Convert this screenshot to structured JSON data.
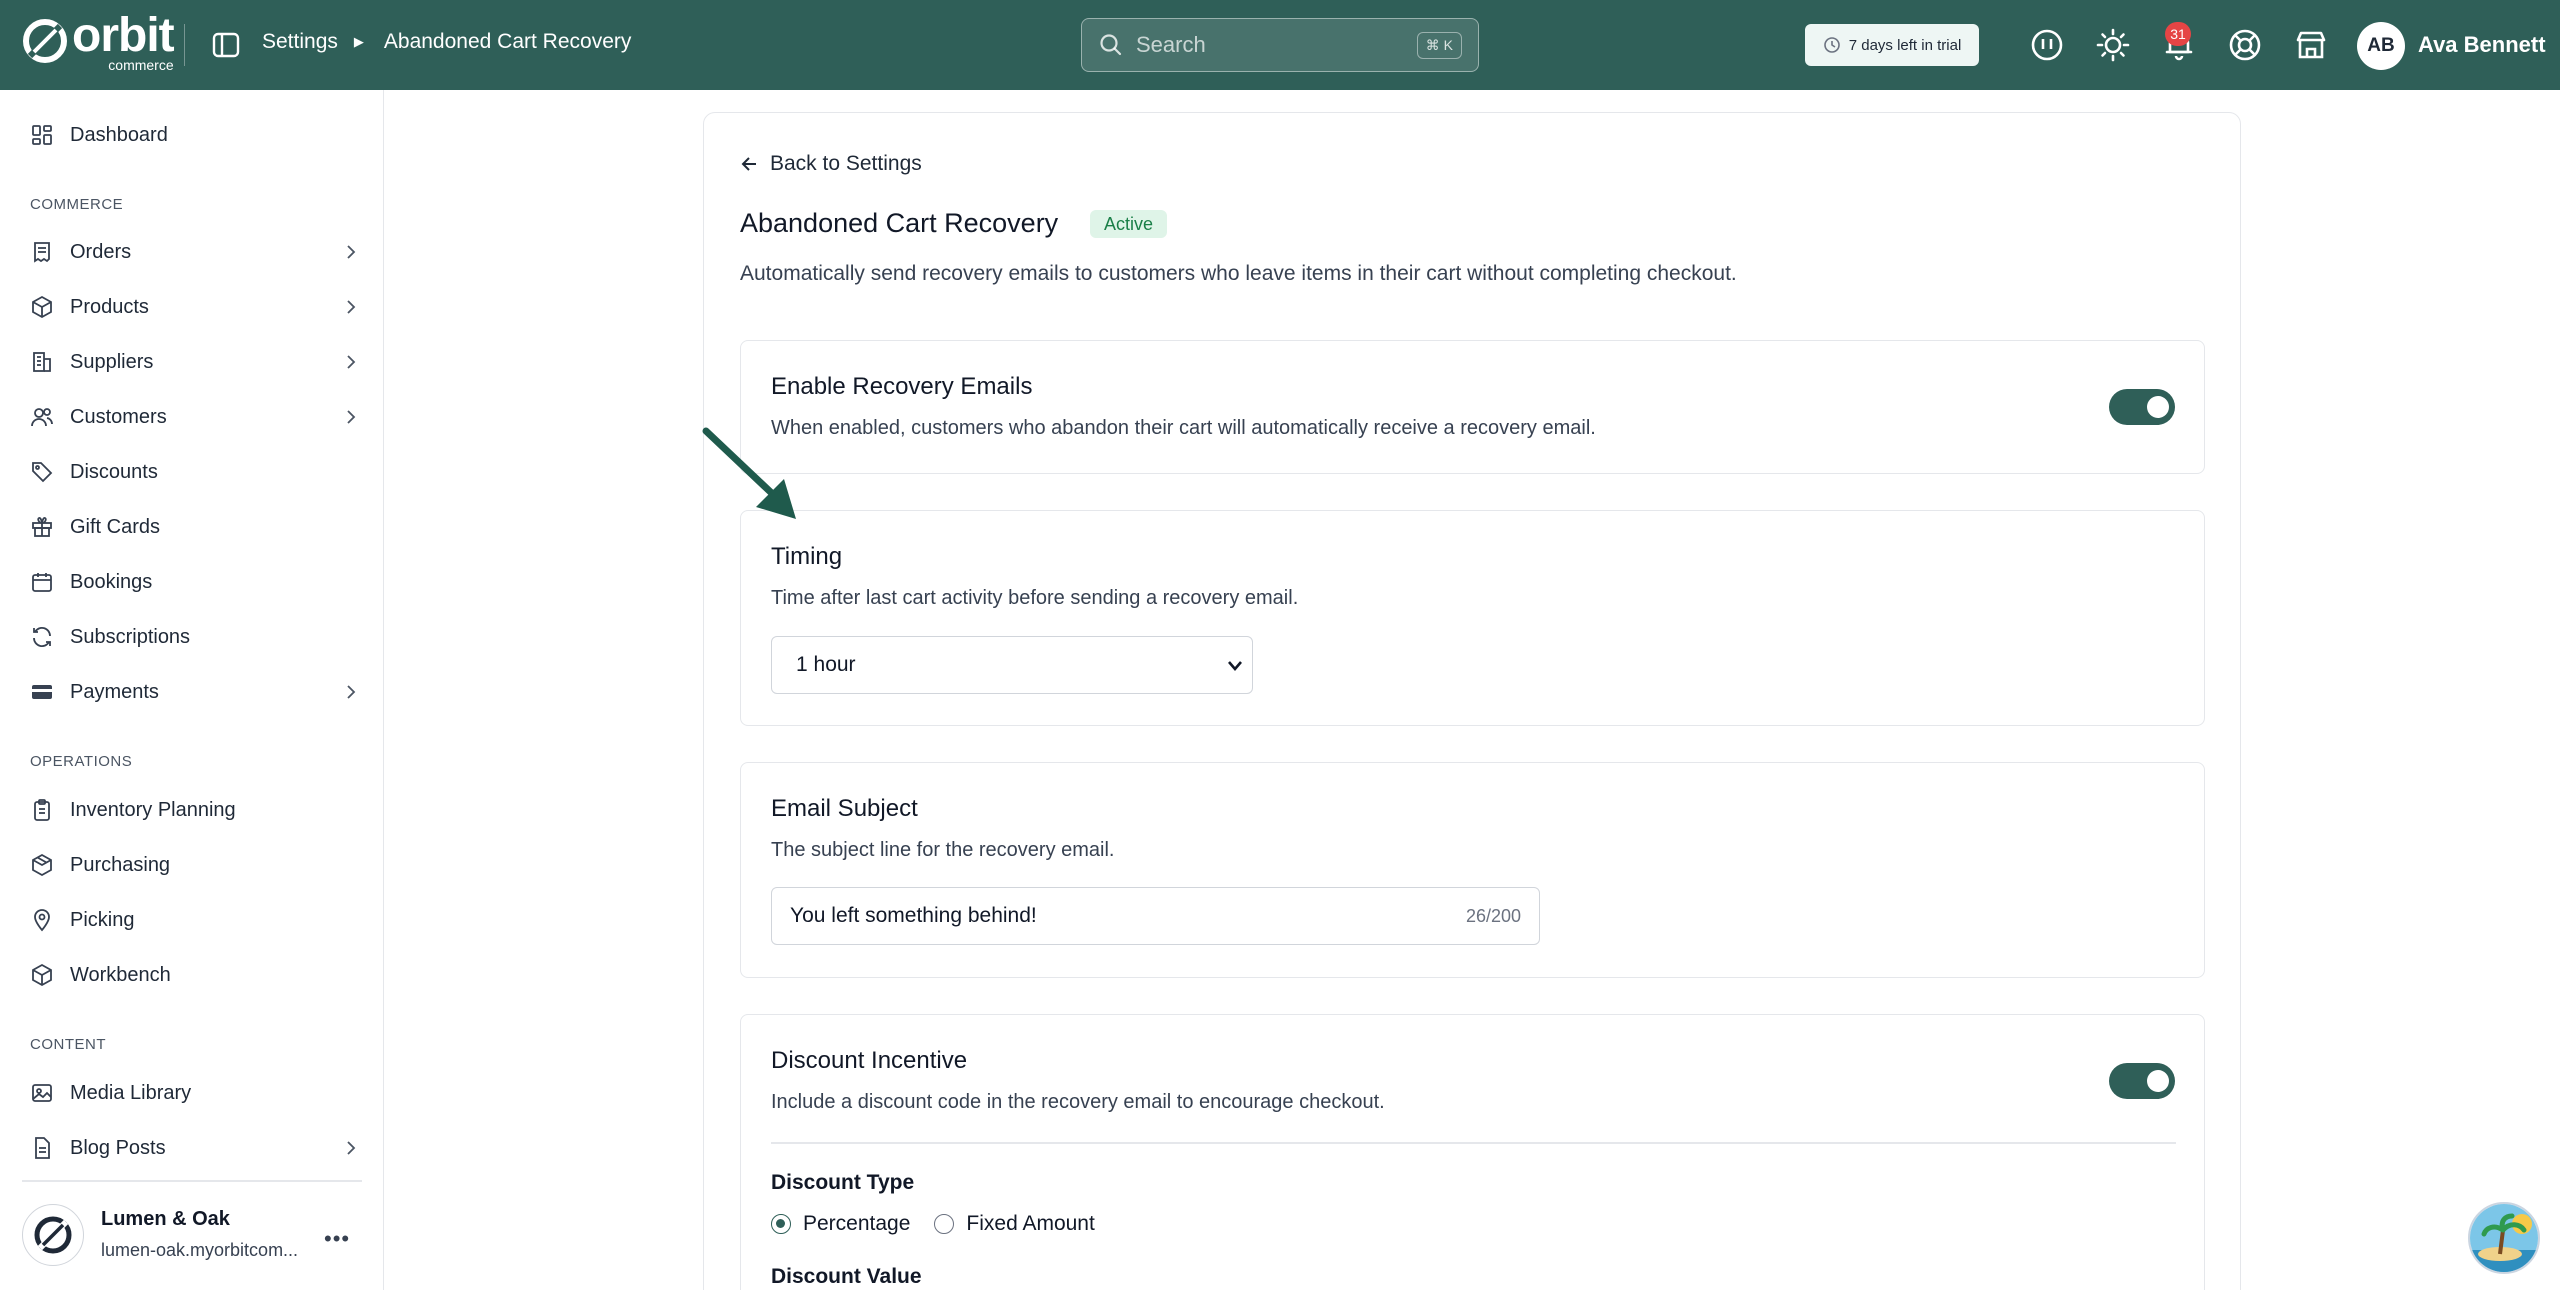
{
  "brand": {
    "word": "orbit",
    "sub": "commerce",
    "color": "#2f5f58"
  },
  "breadcrumb": {
    "parent": "Settings",
    "current": "Abandoned Cart Recovery"
  },
  "search": {
    "placeholder": "Search",
    "shortcut": "⌘ K"
  },
  "trial": {
    "label": "7 days left in trial"
  },
  "notifications": {
    "count": "31"
  },
  "user": {
    "initials": "AB",
    "name": "Ava Bennett"
  },
  "sidebar": {
    "dashboard": "Dashboard",
    "sections": {
      "commerce": "COMMERCE",
      "operations": "OPERATIONS",
      "content": "CONTENT"
    },
    "commerce": [
      "Orders",
      "Products",
      "Suppliers",
      "Customers",
      "Discounts",
      "Gift Cards",
      "Bookings",
      "Subscriptions",
      "Payments"
    ],
    "operations": [
      "Inventory Planning",
      "Purchasing",
      "Picking",
      "Workbench"
    ],
    "content": [
      "Media Library",
      "Blog Posts"
    ],
    "store": {
      "name": "Lumen & Oak",
      "url": "lumen-oak.myorbitcom..."
    }
  },
  "page": {
    "back": "Back to Settings",
    "title": "Abandoned Cart Recovery",
    "status": "Active",
    "description": "Automatically send recovery emails to customers who leave items in their cart without completing checkout."
  },
  "enable": {
    "title": "Enable Recovery Emails",
    "description": "When enabled, customers who abandon their cart will automatically receive a recovery email.",
    "on": true
  },
  "timing": {
    "title": "Timing",
    "description": "Time after last cart activity before sending a recovery email.",
    "selected": "1 hour"
  },
  "subject": {
    "title": "Email Subject",
    "description": "The subject line for the recovery email.",
    "value": "You left something behind!",
    "counter": "26/200"
  },
  "discount": {
    "title": "Discount Incentive",
    "description": "Include a discount code in the recovery email to encourage checkout.",
    "on": true,
    "type_label": "Discount Type",
    "options": [
      "Percentage",
      "Fixed Amount"
    ],
    "selected": "Percentage",
    "value_label": "Discount Value"
  }
}
